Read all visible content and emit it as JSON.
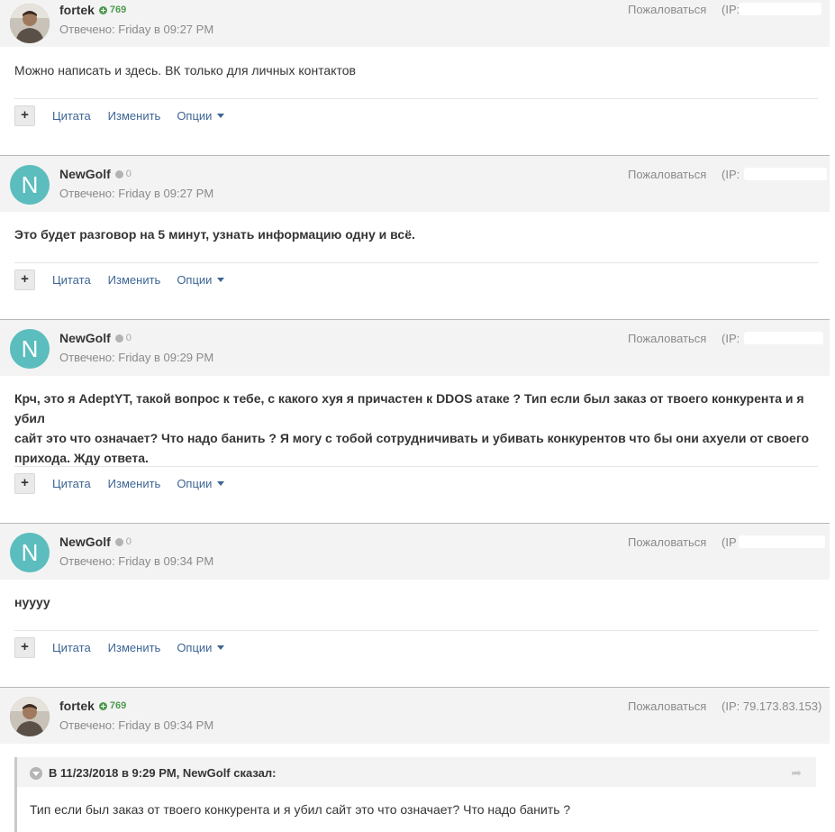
{
  "posts": [
    {
      "author": "fortek",
      "reputation": "769",
      "rep_type": "positive",
      "avatar": {
        "type": "photo"
      },
      "posted": "Отвечено: Friday в 09:27 PM",
      "report": "Пожаловаться",
      "ip": "(IP:",
      "text": "Можно написать и здесь. ВК только для личных контактов",
      "bold": false
    },
    {
      "author": "NewGolf",
      "reputation": "0",
      "rep_type": "neutral",
      "avatar": {
        "type": "letter",
        "letter": "N",
        "color": "#5bbdbd"
      },
      "posted": "Отвечено: Friday в 09:27 PM",
      "report": "Пожаловаться",
      "ip": "(IP:",
      "text": "Это будет разговор на 5 минут, узнать информацию одну и всё.",
      "bold": true
    },
    {
      "author": "NewGolf",
      "reputation": "0",
      "rep_type": "neutral",
      "avatar": {
        "type": "letter",
        "letter": "N",
        "color": "#5bbdbd"
      },
      "posted": "Отвечено: Friday в 09:29 PM",
      "report": "Пожаловаться",
      "ip": "(IP:",
      "text_lines": [
        "Крч, это я AdeptYT, такой вопрос к тебе, с какого хуя я причастен к DDOS атаке ? Тип если был заказ от твоего конкурента и я убил",
        "сайт это что означает? Что надо банить ? Я могу с тобой сотрудничивать и убивать конкурентов что бы они ахуели от своего",
        "прихода. Жду ответа."
      ],
      "bold": true
    },
    {
      "author": "NewGolf",
      "reputation": "0",
      "rep_type": "neutral",
      "avatar": {
        "type": "letter",
        "letter": "N",
        "color": "#5bbdbd"
      },
      "posted": "Отвечено: Friday в 09:34 PM",
      "report": "Пожаловаться",
      "ip": "(IP",
      "text": "нуууу",
      "bold": true
    },
    {
      "author": "fortek",
      "reputation": "769",
      "rep_type": "positive",
      "avatar": {
        "type": "photo"
      },
      "posted": "Отвечено: Friday в 09:34 PM",
      "report": "Пожаловаться",
      "ip": "(IP: 79.173.83.153)",
      "quote": {
        "citation": "В 11/23/2018 в 9:29 PM, NewGolf сказал:",
        "text": "Тип если был заказ от твоего конкурента и я убил сайт это что означает? Что надо банить ?"
      }
    }
  ],
  "toolbar": {
    "plus": "+",
    "quote_label": "Цитата",
    "edit_label": "Изменить",
    "options_label": "Опции"
  },
  "colors": {
    "link": "#3d6594",
    "header_bg": "#f3f3f3",
    "avatar_teal": "#5bbdbd",
    "rep_positive": "#4e9a4e"
  }
}
